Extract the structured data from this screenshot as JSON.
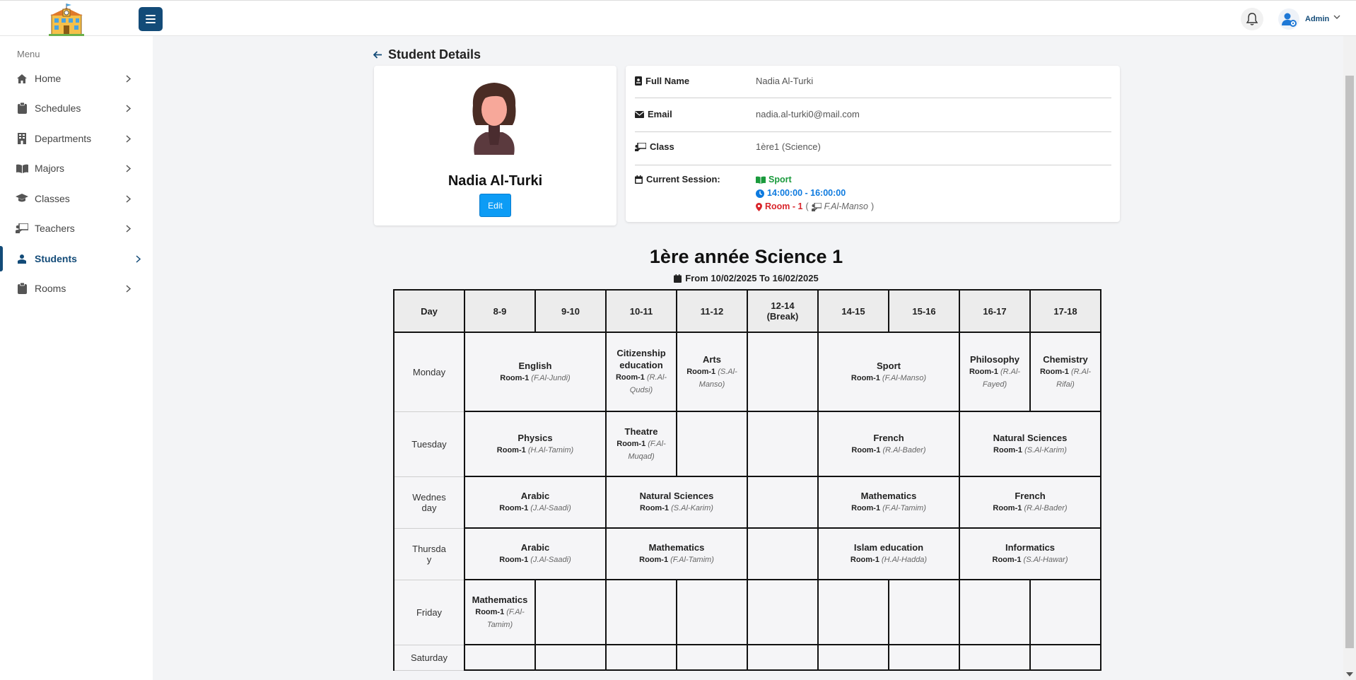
{
  "header": {
    "admin_name": "Admin"
  },
  "sidebar": {
    "menu_title": "Menu",
    "items": [
      {
        "label": "Home",
        "icon": "home-icon"
      },
      {
        "label": "Schedules",
        "icon": "clipboard-icon"
      },
      {
        "label": "Departments",
        "icon": "building-icon"
      },
      {
        "label": "Majors",
        "icon": "book-open-icon"
      },
      {
        "label": "Classes",
        "icon": "graduation-cap-icon"
      },
      {
        "label": "Teachers",
        "icon": "chalkboard-teacher-icon"
      },
      {
        "label": "Students",
        "icon": "student-icon",
        "active": true
      },
      {
        "label": "Rooms",
        "icon": "door-icon"
      }
    ]
  },
  "page": {
    "title": "Student Details"
  },
  "profile": {
    "name": "Nadia Al-Turki",
    "edit_label": "Edit"
  },
  "info": {
    "full_name_label": "Full Name",
    "full_name": "Nadia Al-Turki",
    "email_label": "Email",
    "email": "nadia.al-turki0@mail.com",
    "class_label": "Class",
    "class": "1ère1 (Science)",
    "session_label": "Current Session:",
    "session_subject": "Sport",
    "session_time": "14:00:00 - 16:00:00",
    "session_room": "Room - 1",
    "session_open": "(",
    "session_teacher": "F.Al-Manso",
    "session_close": ")"
  },
  "timetable": {
    "title": "1ère année Science 1",
    "range": "From 10/02/2025 To 16/02/2025",
    "headers": [
      "Day",
      "8-9",
      "9-10",
      "10-11",
      "11-12",
      "12-14\n(Break)",
      "14-15",
      "15-16",
      "16-17",
      "17-18"
    ],
    "rows": [
      {
        "day": "Monday",
        "cells": [
          {
            "span": 2,
            "subject": "English",
            "room": "Room-1",
            "teacher": "(F.Al-Jundi)"
          },
          {
            "span": 1,
            "subject": "Citizenship education",
            "room": "Room-1",
            "teacher": "(R.Al-Qudsi)"
          },
          {
            "span": 1,
            "subject": "Arts",
            "room": "Room-1",
            "teacher": "(S.Al-Manso)"
          },
          {
            "span": 1
          },
          {
            "span": 2,
            "subject": "Sport",
            "room": "Room-1",
            "teacher": "(F.Al-Manso)"
          },
          {
            "span": 1,
            "subject": "Philosophy",
            "room": "Room-1",
            "teacher": "(R.Al-Fayed)"
          },
          {
            "span": 1,
            "subject": "Chemistry",
            "room": "Room-1",
            "teacher": "(R.Al-Rifai)"
          }
        ]
      },
      {
        "day": "Tuesday",
        "cells": [
          {
            "span": 2,
            "subject": "Physics",
            "room": "Room-1",
            "teacher": "(H.Al-Tamim)"
          },
          {
            "span": 1,
            "subject": "Theatre",
            "room": "Room-1",
            "teacher": "(F.Al-Muqad)"
          },
          {
            "span": 1
          },
          {
            "span": 1
          },
          {
            "span": 2,
            "subject": "French",
            "room": "Room-1",
            "teacher": "(R.Al-Bader)"
          },
          {
            "span": 2,
            "subject": "Natural Sciences",
            "room": "Room-1",
            "teacher": "(S.Al-Karim)"
          }
        ]
      },
      {
        "day": "Wednesday",
        "cells": [
          {
            "span": 2,
            "subject": "Arabic",
            "room": "Room-1",
            "teacher": "(J.Al-Saadi)"
          },
          {
            "span": 2,
            "subject": "Natural Sciences",
            "room": "Room-1",
            "teacher": "(S.Al-Karim)"
          },
          {
            "span": 1
          },
          {
            "span": 2,
            "subject": "Mathematics",
            "room": "Room-1",
            "teacher": "(F.Al-Tamim)"
          },
          {
            "span": 2,
            "subject": "French",
            "room": "Room-1",
            "teacher": "(R.Al-Bader)"
          }
        ]
      },
      {
        "day": "Thursday",
        "cells": [
          {
            "span": 2,
            "subject": "Arabic",
            "room": "Room-1",
            "teacher": "(J.Al-Saadi)"
          },
          {
            "span": 2,
            "subject": "Mathematics",
            "room": "Room-1",
            "teacher": "(F.Al-Tamim)"
          },
          {
            "span": 1
          },
          {
            "span": 2,
            "subject": "Islam education",
            "room": "Room-1",
            "teacher": "(H.Al-Hadda)"
          },
          {
            "span": 2,
            "subject": "Informatics",
            "room": "Room-1",
            "teacher": "(S.Al-Hawar)"
          }
        ]
      },
      {
        "day": "Friday",
        "cells": [
          {
            "span": 1,
            "subject": "Mathematics",
            "room": "Room-1",
            "teacher": "(F.Al-Tamim)"
          },
          {
            "span": 1
          },
          {
            "span": 1
          },
          {
            "span": 1
          },
          {
            "span": 1
          },
          {
            "span": 1
          },
          {
            "span": 1
          },
          {
            "span": 1
          },
          {
            "span": 1
          }
        ]
      },
      {
        "day": "Saturday",
        "cells": [
          {
            "span": 1
          },
          {
            "span": 1
          },
          {
            "span": 1
          },
          {
            "span": 1
          },
          {
            "span": 1
          },
          {
            "span": 1
          },
          {
            "span": 1
          },
          {
            "span": 1
          },
          {
            "span": 1
          }
        ]
      }
    ]
  },
  "colors": {
    "brand": "#134b78",
    "edit": "#0d9cf5",
    "session_subject": "#1a9a3c",
    "session_time": "#0d7adf",
    "session_room": "#d9262c"
  }
}
